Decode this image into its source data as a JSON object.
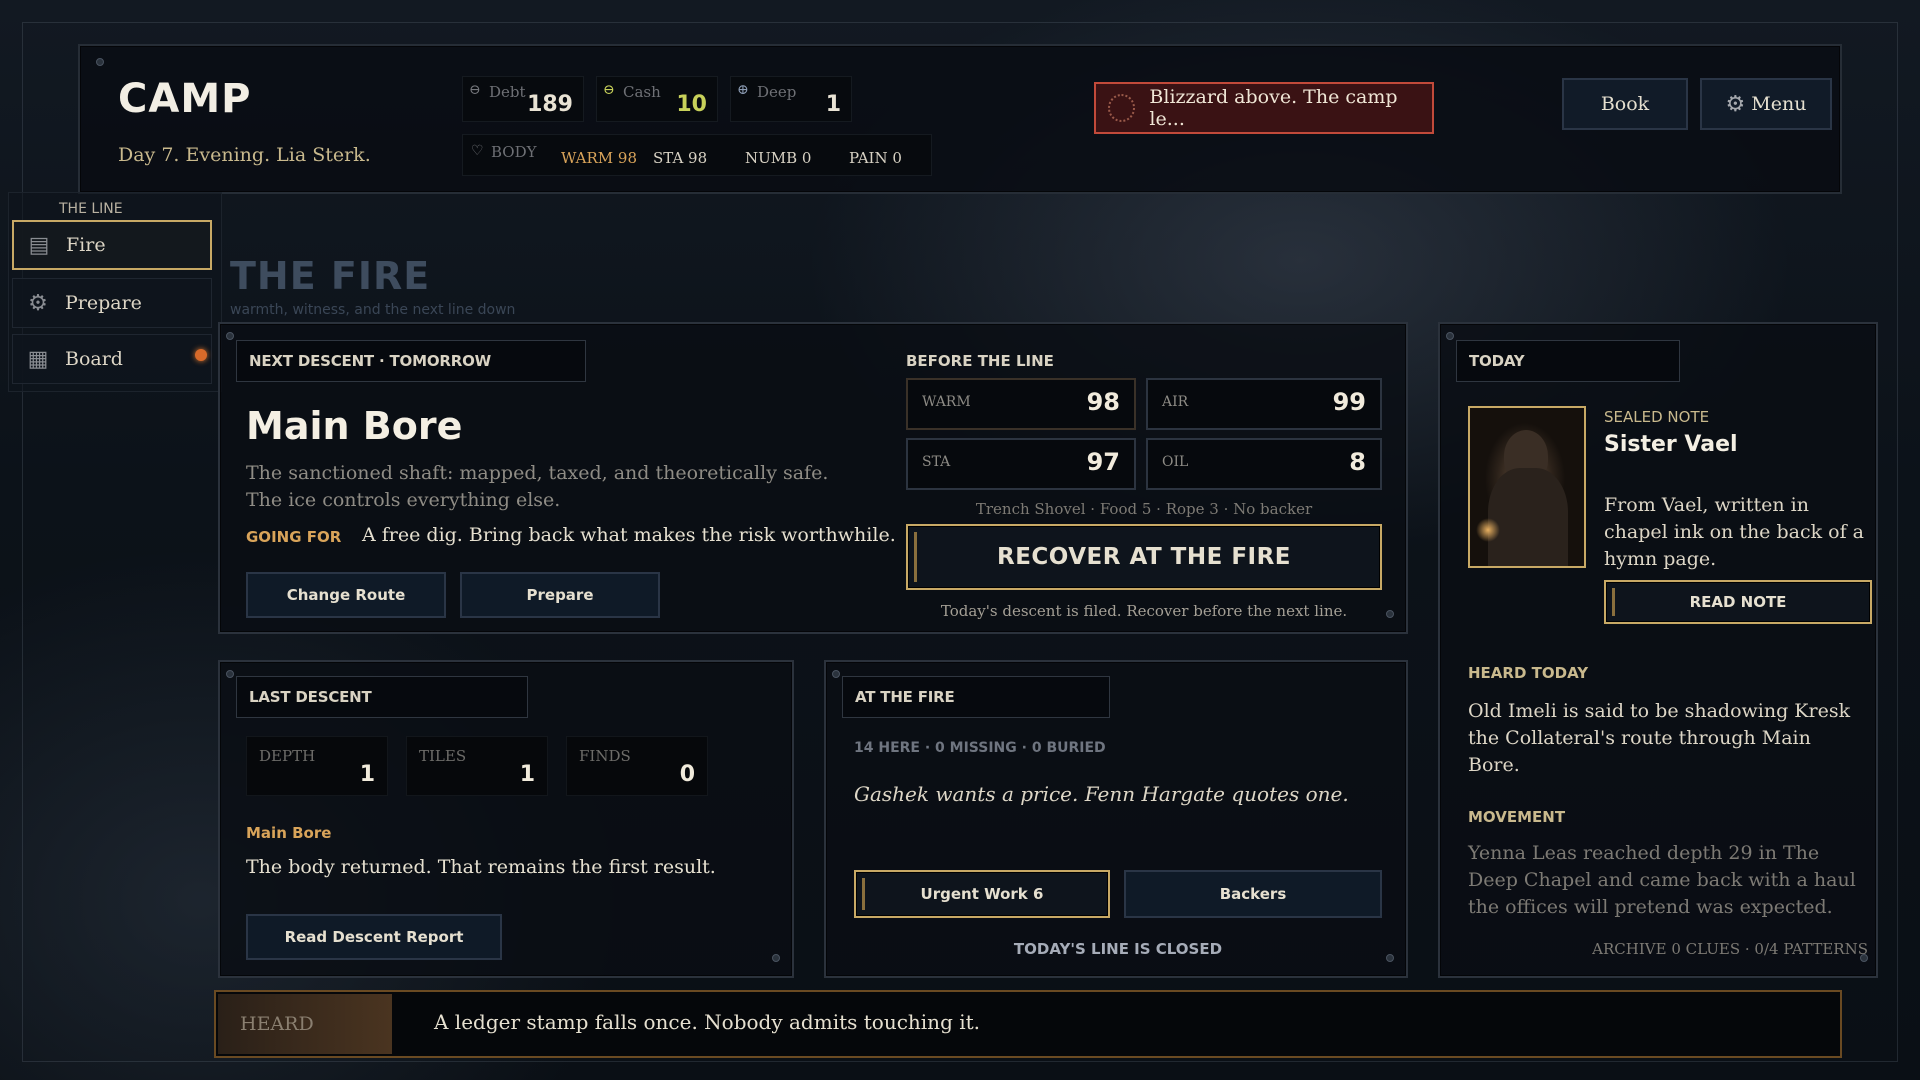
{
  "header": {
    "title": "CAMP",
    "subtitle": "Day 7. Evening. Lia Sterk.",
    "resources": [
      {
        "icon": "debt-icon",
        "label": "Debt",
        "value": "189",
        "color": "#e9e3d4"
      },
      {
        "icon": "cash-icon",
        "label": "Cash",
        "value": "10",
        "color": "#c8d15a"
      },
      {
        "icon": "depth-icon",
        "label": "Deep",
        "value": "1",
        "color": "#e9e3d4"
      }
    ],
    "body_label": "BODY",
    "body_stats": [
      "WARM 98",
      "STA 98",
      "NUMB 0",
      "PAIN 0"
    ],
    "alert": "Blizzard above. The camp le...",
    "book_label": "Book",
    "menu_label": "Menu"
  },
  "sidebar": {
    "section_label": "THE LINE",
    "items": [
      {
        "label": "Fire",
        "icon": "fire-icon",
        "active": true
      },
      {
        "label": "Prepare",
        "icon": "gear-icon",
        "active": false
      },
      {
        "label": "Board",
        "icon": "board-icon",
        "active": false,
        "badge": true
      }
    ]
  },
  "page": {
    "title": "THE FIRE",
    "subtitle": "warmth, witness, and the next line down"
  },
  "next_descent": {
    "header": "NEXT DESCENT · TOMORROW",
    "route_name": "Main Bore",
    "description": "The sanctioned shaft: mapped, taxed, and theoretically safe. The ice controls everything else.",
    "going_for_label": "GOING FOR",
    "going_for_text": "A free dig. Bring back what makes the risk worthwhile.",
    "change_route_label": "Change Route",
    "prepare_label": "Prepare",
    "before_label": "BEFORE THE LINE",
    "stats": [
      {
        "label": "WARM",
        "value": "98"
      },
      {
        "label": "AIR",
        "value": "99"
      },
      {
        "label": "STA",
        "value": "97"
      },
      {
        "label": "OIL",
        "value": "8"
      }
    ],
    "loadout": "Trench Shovel · Food 5 · Rope 3 · No backer",
    "recover_label": "RECOVER AT THE FIRE",
    "recover_note": "Today's descent is filed. Recover before the next line."
  },
  "last_descent": {
    "header": "LAST DESCENT",
    "stats": [
      {
        "label": "DEPTH",
        "value": "1"
      },
      {
        "label": "TILES",
        "value": "1"
      },
      {
        "label": "FINDS",
        "value": "0"
      }
    ],
    "route": "Main Bore",
    "result": "The body returned. That remains the first result.",
    "report_label": "Read Descent Report"
  },
  "at_fire": {
    "header": "AT THE FIRE",
    "counts": "14 HERE · 0 MISSING · 0 BURIED",
    "quote": "Gashek wants a price. Fenn Hargate quotes one.",
    "urgent_label": "Urgent Work 6",
    "backers_label": "Backers",
    "closed_note": "TODAY'S LINE IS CLOSED"
  },
  "today": {
    "header": "TODAY",
    "note_kicker": "SEALED NOTE",
    "note_author": "Sister Vael",
    "note_text": "From Vael, written in chapel ink on the back of a hymn page.",
    "read_note_label": "READ NOTE",
    "heard_header": "HEARD TODAY",
    "heard_text": "Old Imeli is said to be shadowing Kresk the Collateral's route through Main Bore.",
    "movement_header": "MOVEMENT",
    "movement_text": "Yenna Leas reached depth 29 in The Deep Chapel and came back with a haul the offices will pretend was expected.",
    "archive": "ARCHIVE 0 CLUES · 0/4 PATTERNS"
  },
  "footer": {
    "heard_label": "HEARD",
    "heard_text": "A ledger stamp falls once. Nobody admits touching it."
  },
  "colors": {
    "gold": "#c8a965",
    "accent_orange": "#d9a45a",
    "alert_border": "#c24a3a"
  }
}
